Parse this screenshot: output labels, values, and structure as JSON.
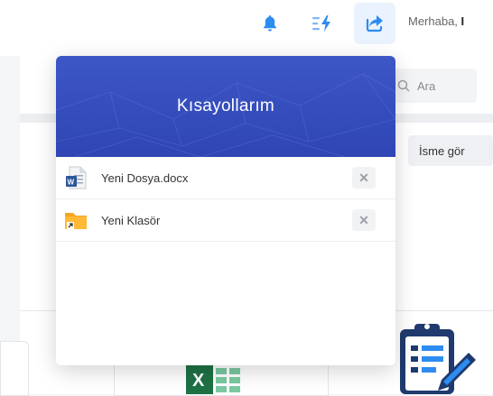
{
  "header": {
    "greeting_prefix": "Merhaba,",
    "greeting_name": "I",
    "icons": [
      "bell-icon",
      "lightning-list-icon",
      "share-icon"
    ]
  },
  "background": {
    "search_placeholder": "Ara",
    "sort_label": "İsme gör"
  },
  "shortcuts": {
    "title": "Kısayollarım",
    "items": [
      {
        "name": "Yeni Dosya.docx",
        "icon": "word-document-icon",
        "remove": "✕"
      },
      {
        "name": "Yeni Klasör",
        "icon": "folder-shortcut-icon",
        "remove": "✕"
      }
    ]
  },
  "colors": {
    "accent": "#3d57c6",
    "icon_blue": "#2d8cf0"
  }
}
